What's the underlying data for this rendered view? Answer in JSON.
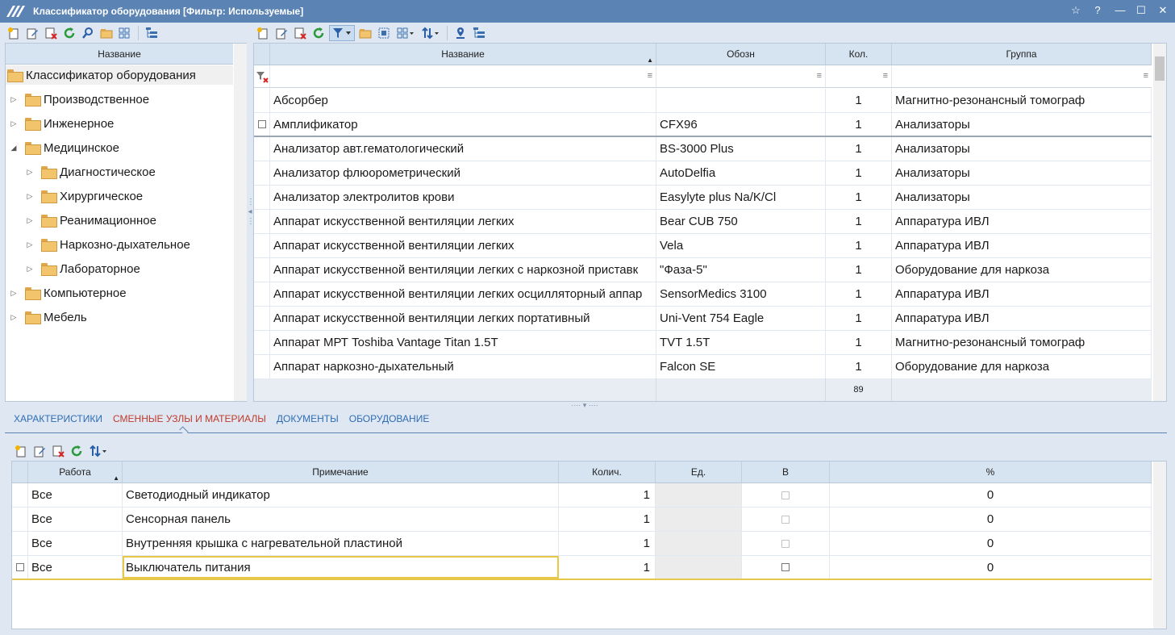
{
  "window": {
    "title": "Классификатор оборудования [Фильтр: Используемые]",
    "buttons": [
      "☆",
      "?",
      "—",
      "☐",
      "✕"
    ]
  },
  "tree": {
    "header": "Название",
    "root": "Классификатор оборудования",
    "items": [
      {
        "label": "Производственное",
        "level": 1,
        "expanded": false
      },
      {
        "label": "Инженерное",
        "level": 1,
        "expanded": false
      },
      {
        "label": "Медицинское",
        "level": 1,
        "expanded": true
      },
      {
        "label": "Диагностическое",
        "level": 2,
        "expanded": false
      },
      {
        "label": "Хирургическое",
        "level": 2,
        "expanded": false
      },
      {
        "label": "Реанимационное",
        "level": 2,
        "expanded": false
      },
      {
        "label": "Наркозно-дыхательное",
        "level": 2,
        "expanded": false
      },
      {
        "label": "Лабораторное",
        "level": 2,
        "expanded": false
      },
      {
        "label": "Компьютерное",
        "level": 1,
        "expanded": false
      },
      {
        "label": "Мебель",
        "level": 1,
        "expanded": false
      }
    ]
  },
  "equipment": {
    "columns": [
      "Название",
      "Обозн",
      "Кол.",
      "Группа"
    ],
    "rows": [
      {
        "name": "Абсорбер",
        "code": "",
        "qty": "1",
        "group": "Магнитно-резонансный томограф"
      },
      {
        "name": "Амплификатор",
        "code": "CFX96",
        "qty": "1",
        "group": "Анализаторы"
      },
      {
        "name": "Анализатор авт.гематологический",
        "code": "BS-3000 Plus",
        "qty": "1",
        "group": "Анализаторы"
      },
      {
        "name": "Анализатор флюорометрический",
        "code": "AutoDelfia",
        "qty": "1",
        "group": "Анализаторы"
      },
      {
        "name": "Анализатор электролитов крови",
        "code": "Easylyte plus Na/K/Cl",
        "qty": "1",
        "group": "Анализаторы"
      },
      {
        "name": "Аппарат искусственной вентиляции легких",
        "code": "Bear CUB 750",
        "qty": "1",
        "group": "Аппаратура ИВЛ"
      },
      {
        "name": "Аппарат искусственной вентиляции легких",
        "code": "Vela",
        "qty": "1",
        "group": "Аппаратура ИВЛ"
      },
      {
        "name": "Аппарат искусственной вентиляции легких  с наркозной приставк",
        "code": "\"Фаза-5\"",
        "qty": "1",
        "group": "Оборудование для наркоза"
      },
      {
        "name": "Аппарат искусственной вентиляции легких осцилляторный аппар",
        "code": "SensorMedics 3100",
        "qty": "1",
        "group": "Аппаратура ИВЛ"
      },
      {
        "name": "Аппарат искусственной вентиляции легких портативный",
        "code": "Uni-Vent 754 Eagle",
        "qty": "1",
        "group": "Аппаратура ИВЛ"
      },
      {
        "name": "Аппарат МРТ Toshiba Vantage Titan 1.5T",
        "code": "TVT 1.5T",
        "qty": "1",
        "group": "Магнитно-резонансный томограф"
      },
      {
        "name": "Аппарат наркозно-дыхательный",
        "code": "Falcon SE",
        "qty": "1",
        "group": "Оборудование для наркоза"
      }
    ],
    "footer_total": "89"
  },
  "tabs": [
    {
      "label": "ХАРАКТЕРИСТИКИ",
      "active": false
    },
    {
      "label": "СМЕННЫЕ УЗЛЫ И МАТЕРИАЛЫ",
      "active": true
    },
    {
      "label": "ДОКУМЕНТЫ",
      "active": false
    },
    {
      "label": "ОБОРУДОВАНИЕ",
      "active": false
    }
  ],
  "parts": {
    "columns": [
      "Работа",
      "Примечание",
      "Колич.",
      "Ед.",
      "В",
      "%"
    ],
    "rows": [
      {
        "work": "Все",
        "note": "Светодиодный индикатор",
        "qty": "1",
        "unit": "",
        "pct": "0"
      },
      {
        "work": "Все",
        "note": "Сенсорная панель",
        "qty": "1",
        "unit": "",
        "pct": "0"
      },
      {
        "work": "Все",
        "note": "Внутренняя крышка с нагревательной пластиной",
        "qty": "1",
        "unit": "",
        "pct": "0"
      },
      {
        "work": "Все",
        "note": "Выключатель питания",
        "qty": "1",
        "unit": "",
        "pct": "0"
      }
    ]
  },
  "colors": {
    "titlebar": "#5b83b4",
    "header": "#d6e3f0",
    "accent_tab": "#c0392b",
    "link_tab": "#2e6cb5",
    "focus": "#e8c84a"
  }
}
